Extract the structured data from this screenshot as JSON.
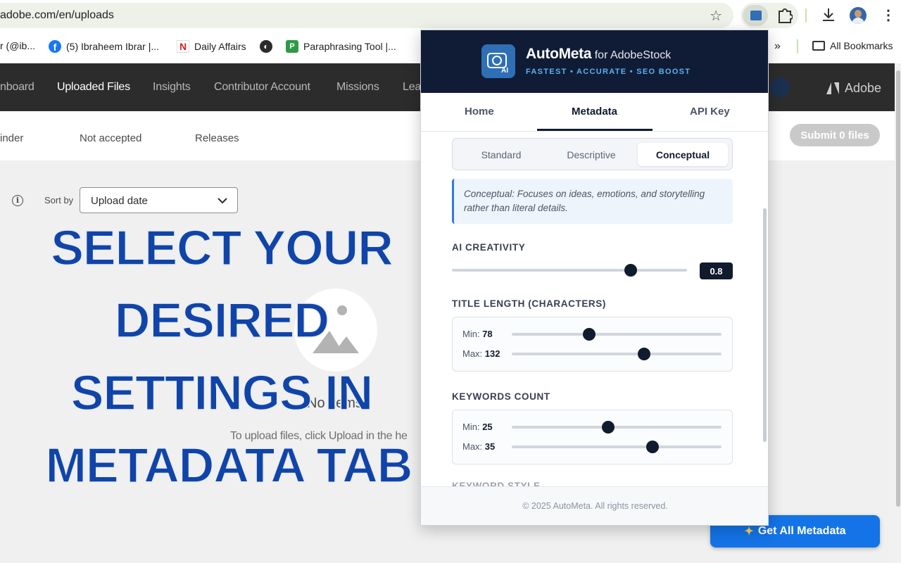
{
  "browser": {
    "url": "adobe.com/en/uploads",
    "bookmarks": [
      {
        "label": "r (@ib..."
      },
      {
        "label": "(5) Ibraheem Ibrar |..."
      },
      {
        "label": "Daily Affairs"
      },
      {
        "label": "Paraphrasing Tool |..."
      }
    ],
    "more_bookmarks": "»",
    "all_bookmarks": "All Bookmarks"
  },
  "adobe_nav": {
    "items": [
      "nboard",
      "Uploaded Files",
      "Insights",
      "Contributor Account",
      "Missions",
      "Lea"
    ],
    "active": "Uploaded Files",
    "brand": "Adobe"
  },
  "subnav": {
    "items": [
      "inder",
      "Not accepted",
      "Releases"
    ],
    "submit_label": "Submit 0 files"
  },
  "toolbar": {
    "sort_label": "Sort by",
    "sort_value": "Upload date"
  },
  "empty_state": {
    "title": "No items",
    "hint": "To upload files, click Upload in the he"
  },
  "overlay": {
    "lines": [
      "SELECT YOUR",
      "DESIRED",
      "SETTINGS IN",
      "METADATA TAB"
    ]
  },
  "get_all_button": "Get All Metadata",
  "extension": {
    "name": "AutoMeta",
    "name_suffix": "for AdobeStock",
    "tagline": "FASTEST • ACCURATE • SEO BOOST",
    "tabs": [
      "Home",
      "Metadata",
      "API Key"
    ],
    "active_tab": "Metadata",
    "styles": [
      "Standard",
      "Descriptive",
      "Conceptual"
    ],
    "active_style": "Conceptual",
    "style_description": "Conceptual: Focuses on ideas, emotions, and storytelling rather than literal details.",
    "ai_creativity": {
      "label": "AI CREATIVITY",
      "value": "0.8",
      "fraction": 0.76
    },
    "title_length": {
      "label": "TITLE LENGTH (CHARACTERS)",
      "min_label": "Min:",
      "min": "78",
      "min_fraction": 0.37,
      "max_label": "Max:",
      "max": "132",
      "max_fraction": 0.63
    },
    "keywords_count": {
      "label": "KEYWORDS COUNT",
      "min_label": "Min:",
      "min": "25",
      "min_fraction": 0.46,
      "max_label": "Max:",
      "max": "35",
      "max_fraction": 0.67
    },
    "next_section_partial": "KEYWORD STYLE",
    "footer": "© 2025 AutoMeta. All rights reserved."
  },
  "colors": {
    "adobe_nav_bg": "#2c2c2c",
    "popup_header_bg": "#101c35",
    "accent_blue": "#1473e6",
    "overlay_text": "#1044a8",
    "slider_thumb": "#111b2e"
  }
}
